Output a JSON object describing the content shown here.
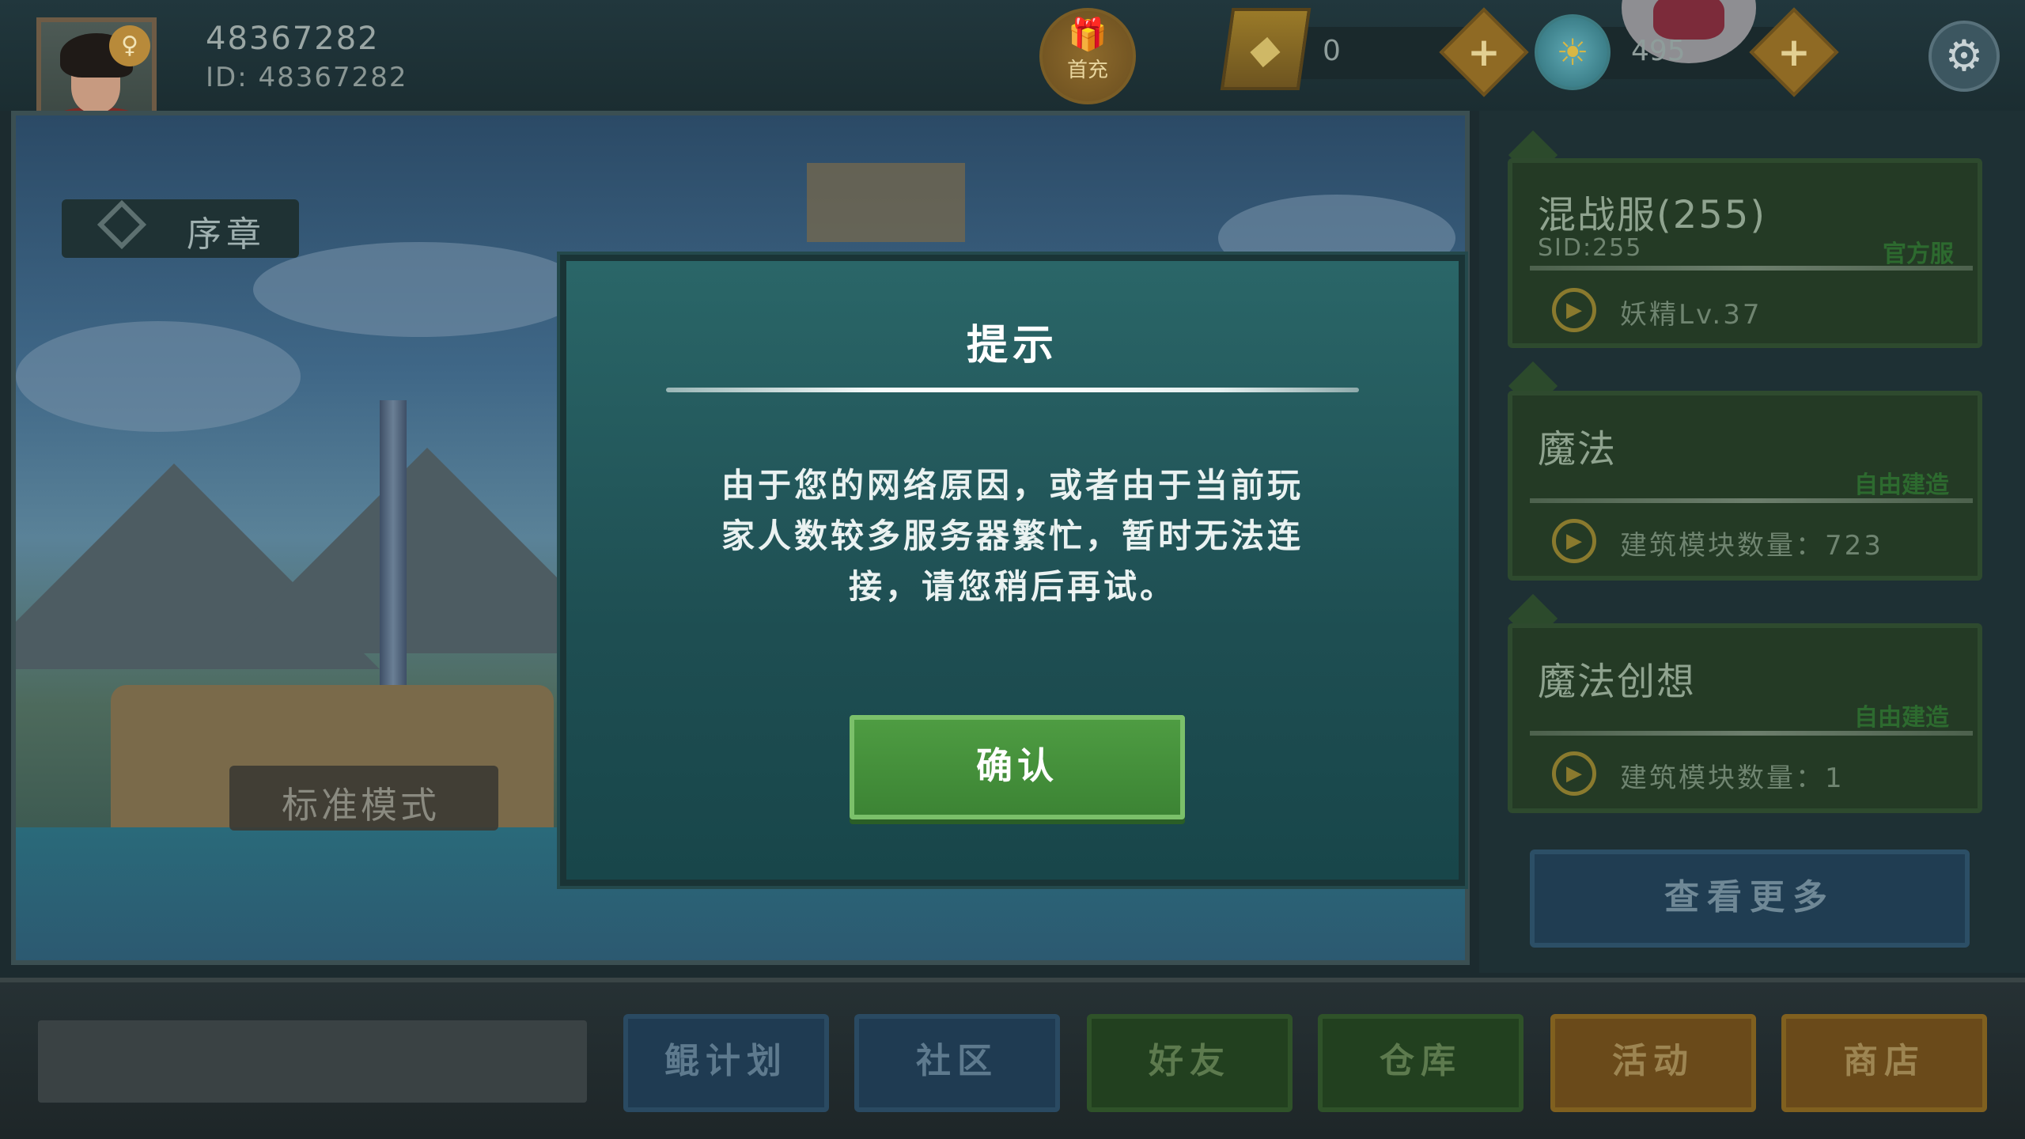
{
  "player": {
    "name": "48367282",
    "id_label": "ID: 48367282",
    "gender_icon": "gender-female-icon"
  },
  "top_bar": {
    "first_charge_label": "首充",
    "gem_count": "0",
    "coin_count": "495"
  },
  "scene": {
    "chapter_label": "序章",
    "mode_label": "标准模式"
  },
  "dialog": {
    "title": "提示",
    "message_lines": [
      "由于您的网络原因，或者由于当前玩",
      "家人数较多服务器繁忙，暂时无法连",
      "接，请您稍后再试。"
    ],
    "confirm_label": "确认"
  },
  "servers": [
    {
      "title": "混战服(255)",
      "sid": "SID:255",
      "tag": "官方服",
      "detail": "妖精Lv.37"
    },
    {
      "title": "魔法",
      "sid": "",
      "tag": "自由建造",
      "detail": "建筑模块数量：723"
    },
    {
      "title": "魔法创想",
      "sid": "",
      "tag": "自由建造",
      "detail": "建筑模块数量：1"
    }
  ],
  "more_label": "查看更多",
  "bottom_nav": [
    {
      "label": "鲲计划",
      "style": "blue"
    },
    {
      "label": "社区",
      "style": "blue"
    },
    {
      "label": "好友",
      "style": "green"
    },
    {
      "label": "仓库",
      "style": "green"
    },
    {
      "label": "活动",
      "style": "orange"
    },
    {
      "label": "商店",
      "style": "orange"
    }
  ],
  "colors": {
    "dialog_bg": "#1e4e52",
    "confirm_green": "#4e9c42",
    "accent_gold": "#8f6a24"
  }
}
